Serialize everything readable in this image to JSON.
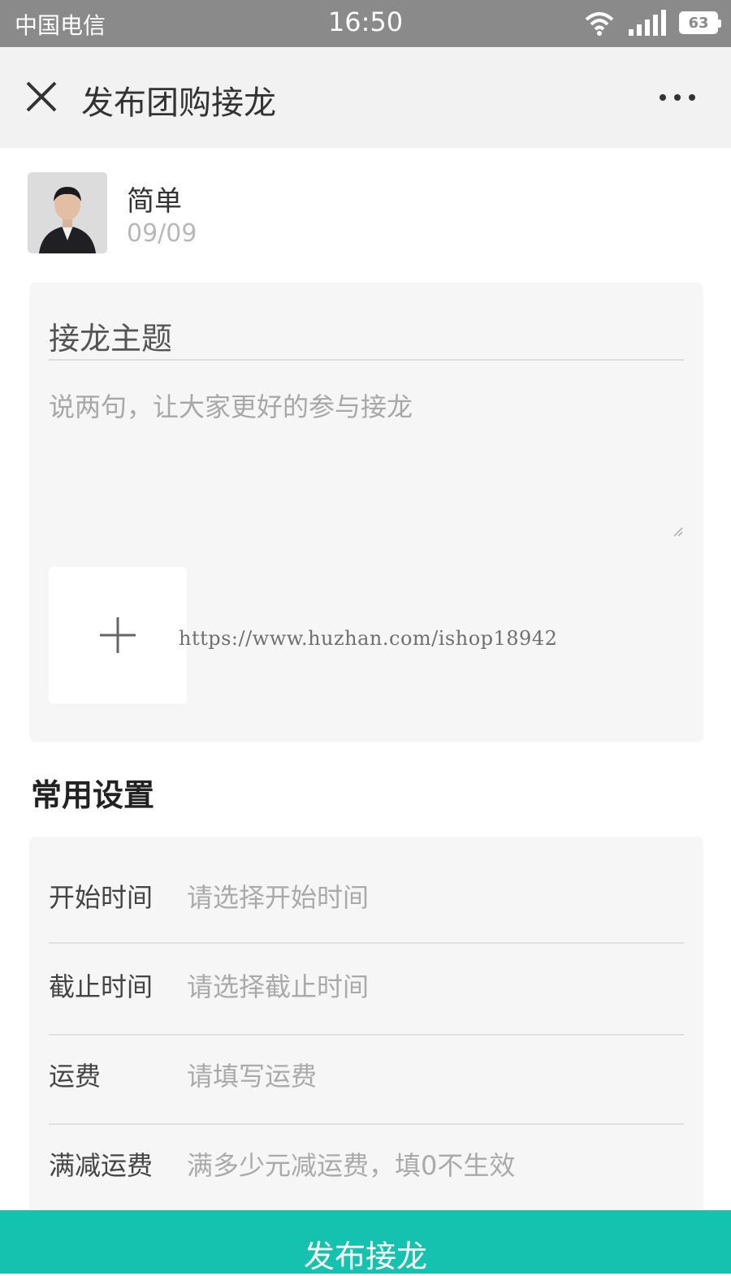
{
  "status_bar": {
    "carrier": "中国电信",
    "time": "16:50",
    "battery": "63",
    "icons": [
      "wifi-icon",
      "signal-icon",
      "battery-icon"
    ]
  },
  "nav": {
    "title": "发布团购接龙",
    "close_icon": "close-icon",
    "more_icon": "more-icon"
  },
  "author": {
    "name": "简单",
    "date": "09/09"
  },
  "topic": {
    "title": "接龙主题",
    "description_placeholder": "说两句，让大家更好的参与接龙",
    "add_image_icon": "plus-icon"
  },
  "watermark": "https://www.huzhan.com/ishop18942",
  "settings": {
    "title": "常用设置",
    "rows": [
      {
        "label": "开始时间",
        "placeholder": "请选择开始时间"
      },
      {
        "label": "截止时间",
        "placeholder": "请选择截止时间"
      },
      {
        "label": "运费",
        "placeholder": "请填写运费"
      },
      {
        "label": "满减运费",
        "placeholder": "满多少元减运费，填0不生效"
      }
    ]
  },
  "publish_button": "发布接龙",
  "colors": {
    "accent": "#15c2b0",
    "status_bar": "#8a8a8a",
    "nav_bar": "#f2f2f2",
    "card": "#f6f6f6"
  }
}
